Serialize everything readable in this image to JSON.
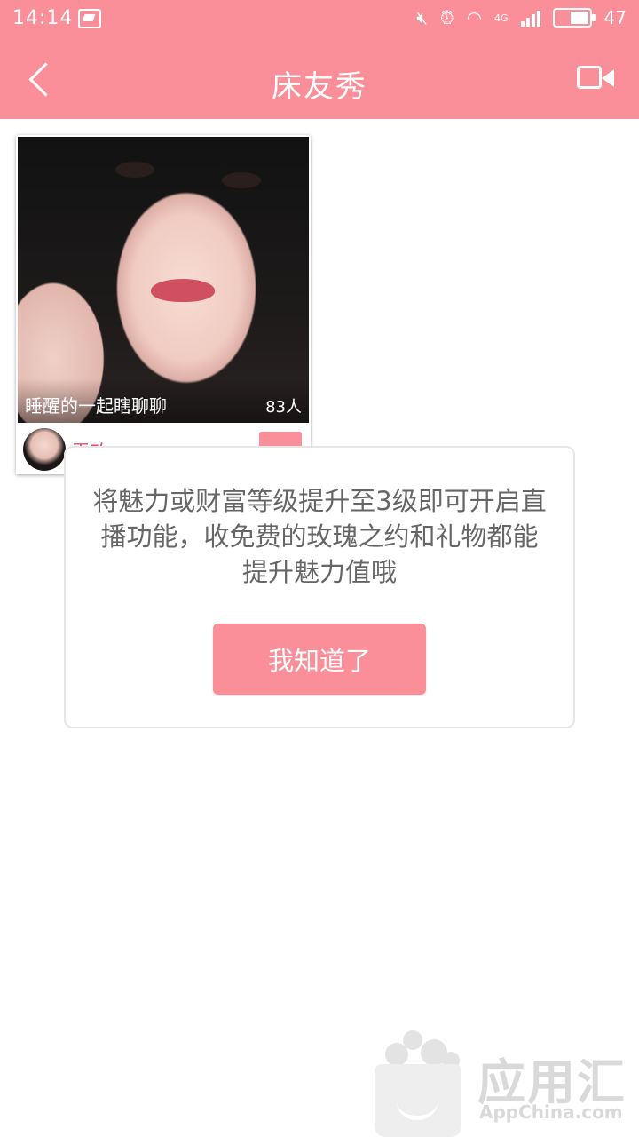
{
  "status_bar": {
    "time": "14:14",
    "network": "4G",
    "battery": "47"
  },
  "header": {
    "title": "床友秀"
  },
  "card": {
    "caption": "睡醒的一起瞎聊聊",
    "viewers": "83人",
    "name": "雷玫"
  },
  "dialog": {
    "message": "将魅力或财富等级提升至3级即可开启直播功能，收免费的玫瑰之约和礼物都能提升魅力值哦",
    "button": "我知道了"
  },
  "watermark": {
    "cn": "应用汇",
    "en": "AppChina.com"
  }
}
